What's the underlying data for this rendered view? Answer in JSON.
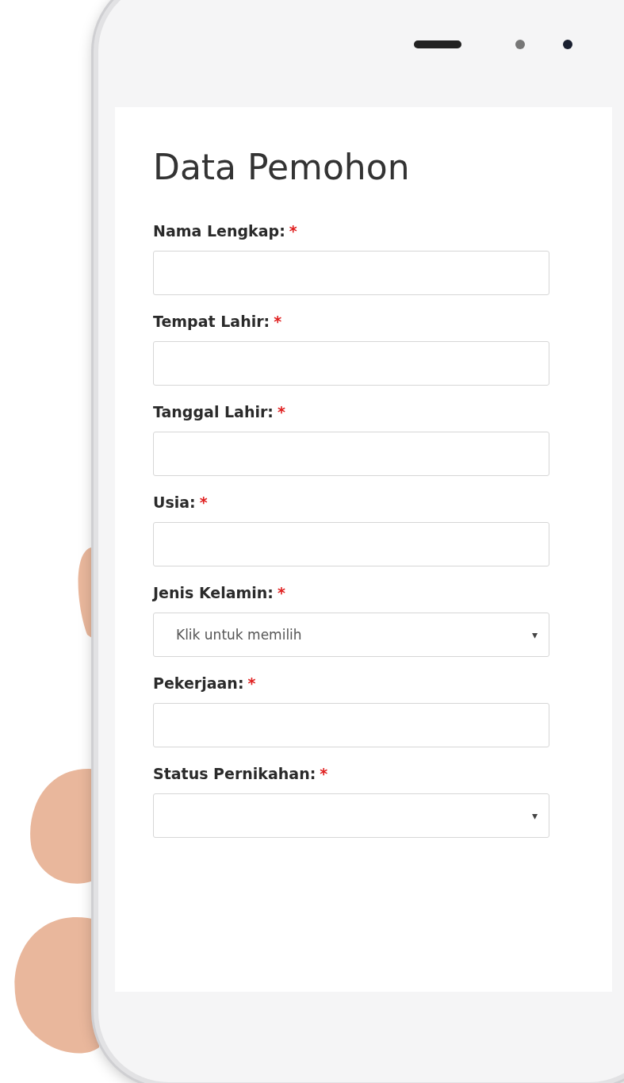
{
  "title": "Data Pemohon",
  "fields": [
    {
      "label": "Nama Lengkap:",
      "required_mark": "*",
      "kind": "text"
    },
    {
      "label": "Tempat Lahir:",
      "required_mark": "*",
      "kind": "text"
    },
    {
      "label": "Tanggal Lahir:",
      "required_mark": "*",
      "kind": "text"
    },
    {
      "label": "Usia:",
      "required_mark": "*",
      "kind": "text"
    },
    {
      "label": "Jenis Kelamin:",
      "required_mark": "*",
      "kind": "select",
      "placeholder": "Klik untuk memilih",
      "caret": "▾"
    },
    {
      "label": "Pekerjaan:",
      "required_mark": "*",
      "kind": "text"
    },
    {
      "label": "Status Pernikahan:",
      "required_mark": "*",
      "kind": "select",
      "caret": "▾"
    }
  ]
}
